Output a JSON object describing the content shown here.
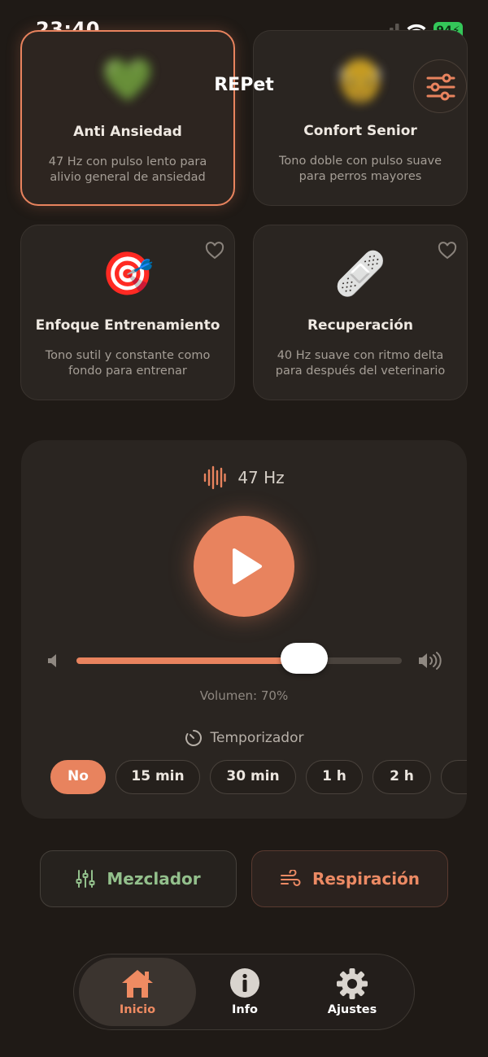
{
  "status_bar": {
    "time": "23:40",
    "battery": "94"
  },
  "app": {
    "title": "REPet"
  },
  "cards": [
    {
      "emoji": "💚",
      "title": "Anti Ansiedad",
      "description": "47 Hz con pulso lento para alivio general de ansiedad",
      "active": true
    },
    {
      "emoji": "👴",
      "title": "Confort Senior",
      "description": "Tono doble con pulso suave para perros mayores",
      "active": false
    },
    {
      "emoji": "🎯",
      "title": "Enfoque Entrenamiento",
      "description": "Tono sutil y constante como fondo para entrenar",
      "active": false
    },
    {
      "emoji": "🩹",
      "title": "Recuperación",
      "description": "40 Hz suave con ritmo delta para después del veterinario",
      "active": false
    }
  ],
  "player": {
    "frequency": "47 Hz",
    "volume": 0.7,
    "volume_label": "Volumen: 70%",
    "timer_label": "Temporizador",
    "timer_options": [
      "No",
      "15 min",
      "30 min",
      "1 h",
      "2 h"
    ],
    "timer_selected": "No"
  },
  "actions": {
    "mixer": "Mezclador",
    "breathing": "Respiración"
  },
  "tabs": [
    {
      "label": "Inicio",
      "icon": "home-icon",
      "active": true
    },
    {
      "label": "Info",
      "icon": "info-icon",
      "active": false
    },
    {
      "label": "Ajustes",
      "icon": "gear-icon",
      "active": false
    }
  ],
  "colors": {
    "accent": "#e8835e",
    "mixer_green": "#93c08c",
    "background": "#1f1a16"
  }
}
